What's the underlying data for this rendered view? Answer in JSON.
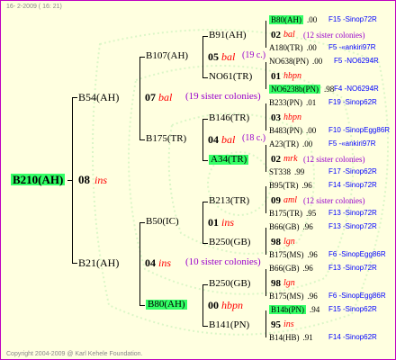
{
  "header": {
    "date": "16- 2-2009 ( 16: 21)"
  },
  "footer": {
    "copyright": "Copyright 2004-2009 @ Karl Kehele Foundation."
  },
  "colors": {
    "border": "#c000c0",
    "background": "#ffffe0",
    "highlight": "#33ff66",
    "red": "#ff0000",
    "purple": "#9900cc",
    "blue": "#0000ff"
  },
  "root": {
    "name": "B210(AH)",
    "year": "08",
    "origin": "ins"
  },
  "l1": [
    {
      "name": "B54(AH)",
      "year": "07",
      "origin": "bal",
      "siblings": "(19 sister colonies)"
    },
    {
      "name": "B21(AH)",
      "year": "04",
      "origin": "ins",
      "siblings": "(10 sister colonies)"
    }
  ],
  "l2": [
    {
      "name": "B107(AH)",
      "year": "05",
      "origin": "bal",
      "siblings": "(19 c.)"
    },
    {
      "name": "B175(TR)",
      "year": "04",
      "origin": "bal",
      "siblings": "(18 c.)"
    },
    {
      "name": "B50(IC)",
      "year": "01",
      "origin": "ins",
      "siblings": ""
    },
    {
      "name": "B80(AH)",
      "year": "00",
      "origin": "hbpn",
      "siblings": ""
    }
  ],
  "l3": [
    {
      "name": "B91(AH)",
      "year": "02",
      "origin": "bal",
      "siblings": "(12 sister colonies)"
    },
    {
      "name": "NO61(TR)",
      "year": "01",
      "origin": "hbpn",
      "siblings": ""
    },
    {
      "name": "B146(TR)",
      "year": "03",
      "origin": "hbpn",
      "siblings": ""
    },
    {
      "name": "A34(TR)",
      "year": "02",
      "origin": "mrk",
      "siblings": "(12 sister colonies)"
    },
    {
      "name": "B213(TR)",
      "year": "09",
      "origin": "aml",
      "siblings": "(12 sister colonies)"
    },
    {
      "name": "B250(GB)",
      "year": "98",
      "origin": "lgn",
      "siblings": ""
    },
    {
      "name": "B250(GB)",
      "year": "98",
      "origin": "lgn",
      "siblings": ""
    },
    {
      "name": "B141(PN)",
      "year": "95",
      "origin": "ins",
      "siblings": ""
    }
  ],
  "l4": [
    {
      "name": "B80(AH)",
      "score": ".00",
      "code": "F15 -Sinop72R"
    },
    {
      "name": "A180(TR)",
      "score": ".00",
      "code": "F5 -«ankiri97R"
    },
    {
      "name": "NO638(PN)",
      "score": ".00",
      "code": "F5 -NO6294R"
    },
    {
      "name": "NO6238b(PN)",
      "score": ".98",
      "code": "F4 -NO6294R"
    },
    {
      "name": "B233(PN)",
      "score": ".01",
      "code": "F19 -Sinop62R"
    },
    {
      "name": "B483(PN)",
      "score": ".00",
      "code": "F10 -SinopEgg86R"
    },
    {
      "name": "A23(TR)",
      "score": ".00",
      "code": "F5 -«ankiri97R"
    },
    {
      "name": "ST338",
      "score": ".99",
      "code": "F17 -Sinop62R"
    },
    {
      "name": "B95(TR)",
      "score": ".96",
      "code": "F14 -Sinop72R"
    },
    {
      "name": "B175(TR)",
      "score": ".95",
      "code": "F13 -Sinop72R"
    },
    {
      "name": "B66(GB)",
      "score": ".96",
      "code": "F13 -Sinop72R"
    },
    {
      "name": "B175(MS)",
      "score": ".96",
      "code": "F6 -SinopEgg86R"
    },
    {
      "name": "B66(GB)",
      "score": ".96",
      "code": "F13 -Sinop72R"
    },
    {
      "name": "B175(MS)",
      "score": ".96",
      "code": "F6 -SinopEgg86R"
    },
    {
      "name": "B14b(PN)",
      "score": ".94",
      "code": "F15 -Sinop62R"
    },
    {
      "name": "B14(HB)",
      "score": ".91",
      "code": "F14 -Sinop62R"
    }
  ]
}
